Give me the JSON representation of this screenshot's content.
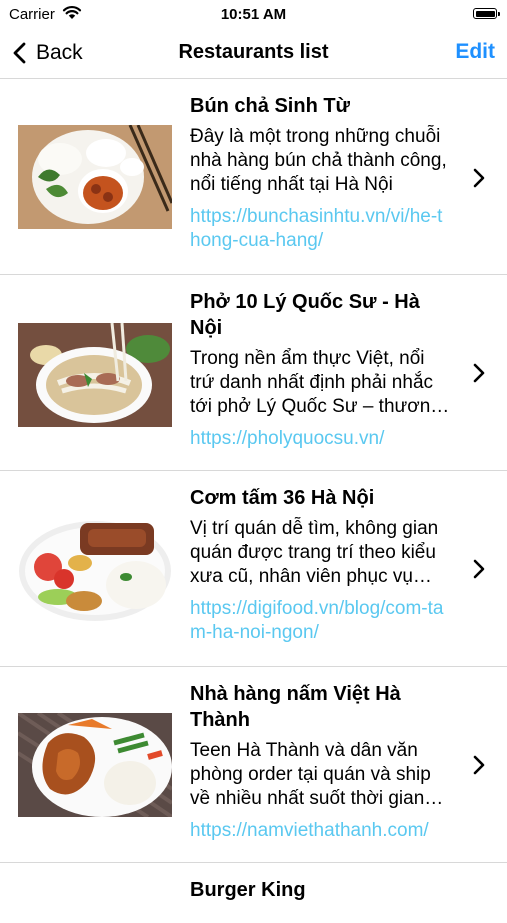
{
  "status_bar": {
    "carrier": "Carrier",
    "time": "10:51 AM"
  },
  "nav": {
    "back_label": "Back",
    "title": "Restaurants list",
    "edit_label": "Edit"
  },
  "restaurants": [
    {
      "name": "Bún chả Sinh Từ",
      "description": "Đây là một trong những chuỗi nhà hàng bún chả thành công, nổi tiếng nhất tại Hà Nội",
      "link": "https://bunchasinhtu.vn/vi/he-thong-cua-hang/",
      "image": "bun-cha-photo"
    },
    {
      "name": "Phở 10 Lý Quốc Sư - Hà Nội",
      "description": "Trong nền ẩm thực Việt, nổi trứ danh nhất định phải nhắc tới phở Lý Quốc Sư – thương hiệu nổi tiếng",
      "link": "https://pholyquocsu.vn/",
      "image": "pho-photo"
    },
    {
      "name": "Cơm tấm 36 Hà Nội",
      "description": "Vị trí quán dễ tìm, không gian quán được trang trí theo kiểu xưa cũ, nhân viên phục vụ nhiệt tình",
      "link": "https://digifood.vn/blog/com-tam-ha-noi-ngon/",
      "image": "com-tam-photo"
    },
    {
      "name": "Nhà hàng nấm Việt Hà Thành",
      "description": "Teen Hà Thành và dân văn phòng order tại quán và ship về nhiều nhất suốt thời gian qua",
      "link": "https://namviethathanh.com/",
      "image": "chicken-rice-photo"
    },
    {
      "name": "Burger King"
    }
  ]
}
